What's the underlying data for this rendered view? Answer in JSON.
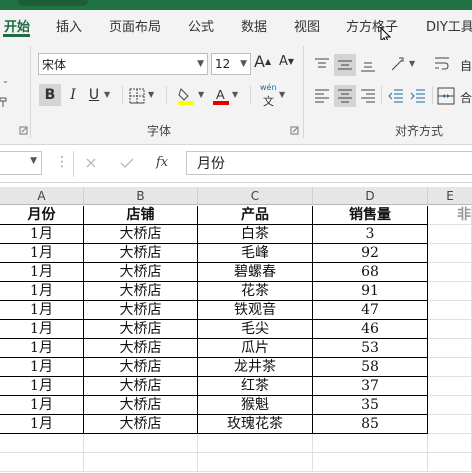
{
  "ribbon_tabs": [
    "开始",
    "插入",
    "页面布局",
    "公式",
    "数据",
    "视图",
    "方方格子",
    "DIY工具"
  ],
  "font": {
    "name": "宋体",
    "size": "12",
    "grow_glyph": "A",
    "shrink_glyph": "A",
    "bold": "B",
    "italic": "I",
    "underline": "U",
    "wen": "wén",
    "wen_char": "文"
  },
  "group_labels": {
    "font": "字体",
    "align": "对齐方式"
  },
  "right_edge": {
    "wrap": "自",
    "merge": "合"
  },
  "formula_bar": {
    "fx": "fx",
    "value": "月份"
  },
  "columns": [
    "A",
    "B",
    "C",
    "D",
    "E"
  ],
  "partial_header_char": "非",
  "table": {
    "headers": [
      "月份",
      "店铺",
      "产品",
      "销售量"
    ],
    "rows": [
      [
        "1月",
        "大桥店",
        "白茶",
        "3"
      ],
      [
        "1月",
        "大桥店",
        "毛峰",
        "92"
      ],
      [
        "1月",
        "大桥店",
        "碧螺春",
        "68"
      ],
      [
        "1月",
        "大桥店",
        "花茶",
        "91"
      ],
      [
        "1月",
        "大桥店",
        "铁观音",
        "47"
      ],
      [
        "1月",
        "大桥店",
        "毛尖",
        "46"
      ],
      [
        "1月",
        "大桥店",
        "瓜片",
        "53"
      ],
      [
        "1月",
        "大桥店",
        "龙井茶",
        "58"
      ],
      [
        "1月",
        "大桥店",
        "红茶",
        "37"
      ],
      [
        "1月",
        "大桥店",
        "猴魁",
        "35"
      ],
      [
        "1月",
        "大桥店",
        "玫瑰花茶",
        "85"
      ]
    ]
  },
  "colors": {
    "accent": "#1e6b3f",
    "title_bar": "#217346",
    "highlight": "#ffff00",
    "font_color": "#e00000"
  }
}
